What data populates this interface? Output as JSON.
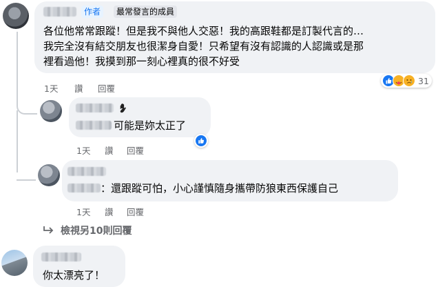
{
  "comment1": {
    "author_badge": "作者",
    "top_fan_badge": "最常發言的成員",
    "lines": [
      "各位他常常跟蹤！但是我不與他人交惡！我的高跟鞋都是訂製代言的…",
      "我完全沒有結交朋友也很潔身自愛！只希望有沒有認識的人認識或是那",
      "裡看過他！我摸到那一刻心裡真的很不好受"
    ],
    "time": "1天",
    "like": "讚",
    "reply": "回覆",
    "reaction_count": "31"
  },
  "reply1": {
    "text": "可能是妳太正了",
    "time": "1天",
    "like": "讚",
    "reply": "回覆"
  },
  "reply2": {
    "text": "：還跟蹤可怕，小心謹慎隨身攜帶防狼東西保護自己",
    "time": "1天",
    "like": "讚",
    "reply": "回覆"
  },
  "more_replies": "檢視另10則回覆",
  "comment2": {
    "text": "你太漂亮了！"
  },
  "colors": {
    "bubble": "#f0f2f5",
    "muted": "#65676b",
    "accent": "#1877f2"
  }
}
